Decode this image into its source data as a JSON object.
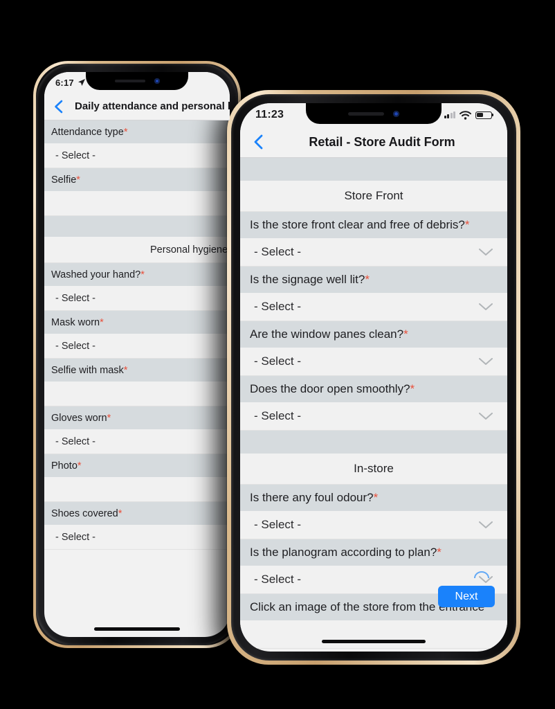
{
  "back_phone": {
    "status_bar": {
      "time": "6:17",
      "location_icon": "location-arrow-icon"
    },
    "nav": {
      "back_icon": "chevron-left-icon",
      "title": "Daily attendance and personal hygiene"
    },
    "form_rows": [
      {
        "type": "question",
        "label": "Attendance type",
        "required": true
      },
      {
        "type": "select",
        "value": "- Select -"
      },
      {
        "type": "question",
        "label": "Selfie",
        "required": true
      },
      {
        "type": "blank"
      },
      {
        "type": "gap"
      },
      {
        "type": "section",
        "label": "Personal hygiene check"
      },
      {
        "type": "question",
        "label": "Washed your hand?",
        "required": true
      },
      {
        "type": "select",
        "value": "- Select -"
      },
      {
        "type": "question",
        "label": "Mask worn",
        "required": true
      },
      {
        "type": "select",
        "value": "- Select -"
      },
      {
        "type": "question",
        "label": "Selfie with mask",
        "required": true
      },
      {
        "type": "blank"
      },
      {
        "type": "question",
        "label": "Gloves worn",
        "required": true
      },
      {
        "type": "select",
        "value": "- Select -"
      },
      {
        "type": "question",
        "label": "Photo",
        "required": true
      },
      {
        "type": "blank"
      },
      {
        "type": "question",
        "label": "Shoes covered",
        "required": true
      },
      {
        "type": "select",
        "value": "- Select -"
      }
    ]
  },
  "front_phone": {
    "status_bar": {
      "time": "11:23",
      "cellular_bars_filled": 2,
      "cellular_bars_total": 4,
      "wifi_icon": "wifi-icon",
      "battery_percent": 45
    },
    "nav": {
      "back_icon": "chevron-left-icon",
      "title": "Retail - Store Audit Form"
    },
    "form_rows": [
      {
        "type": "gap"
      },
      {
        "type": "section",
        "label": "Store Front"
      },
      {
        "type": "question",
        "label": "Is the store front clear and free of debris?",
        "required": true
      },
      {
        "type": "select",
        "value": "- Select -"
      },
      {
        "type": "question",
        "label": "Is the signage well lit?",
        "required": true
      },
      {
        "type": "select",
        "value": "- Select -"
      },
      {
        "type": "question",
        "label": "Are the window panes clean?",
        "required": true
      },
      {
        "type": "select",
        "value": "- Select -"
      },
      {
        "type": "question",
        "label": "Does the door open smoothly?",
        "required": true
      },
      {
        "type": "select",
        "value": "- Select -"
      },
      {
        "type": "gap"
      },
      {
        "type": "section",
        "label": "In-store"
      },
      {
        "type": "question",
        "label": "Is there any foul odour?",
        "required": true
      },
      {
        "type": "select",
        "value": "- Select -"
      },
      {
        "type": "question",
        "label": "Is the planogram according to plan?",
        "required": true
      },
      {
        "type": "select",
        "value": "- Select -"
      },
      {
        "type": "question",
        "label": "Click an image of the store from the entrance",
        "required": false
      },
      {
        "type": "blank"
      }
    ],
    "next_button": {
      "label": "Next"
    }
  },
  "colors": {
    "accent_blue": "#1a82fb",
    "required_asterisk": "#e8513c",
    "question_row_bg": "#d6dbde",
    "select_row_bg": "#f1f1f1",
    "screen_bg": "#f2f2f2",
    "page_background": "#000000"
  }
}
